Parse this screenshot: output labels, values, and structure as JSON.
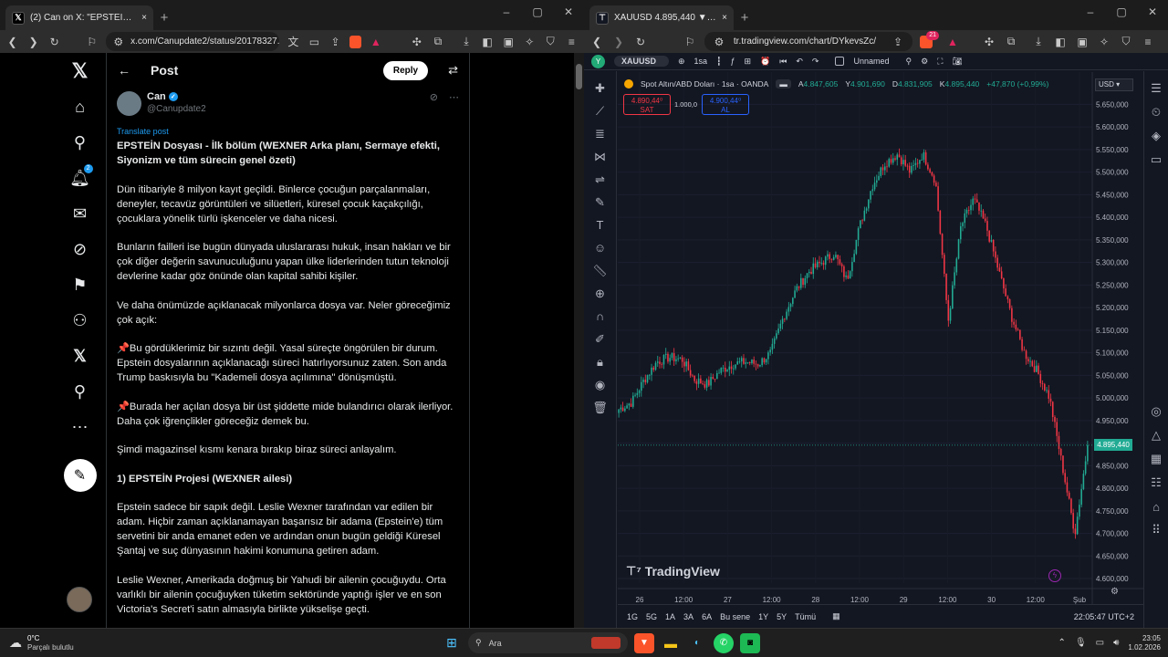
{
  "left": {
    "tab_title": "(2) Can on X: \"EPSTEİN Dosyası -",
    "url": "x.com/Canupdate2/status/20178327...",
    "header": {
      "title": "Post",
      "reply_label": "Reply"
    },
    "author": {
      "name": "Can",
      "handle": "@Canupdate2"
    },
    "notification_count": "2",
    "translate": "Translate post",
    "paragraphs": [
      {
        "text": "EPSTEİN Dosyası - İlk bölüm (WEXNER Arka planı, Sermaye efekti, Siyonizm ve tüm sürecin genel özeti)",
        "bold": true
      },
      {
        "text": "Dün itibariyle 8 milyon kayıt geçildi. Binlerce çocuğun parçalanmaları, deneyler, tecavüz görüntüleri ve silüetleri, küresel çocuk kaçakçılığı, çocuklara yönelik türlü işkenceler ve daha nicesi.",
        "bold": false
      },
      {
        "text": "Bunların failleri ise bugün dünyada uluslararası hukuk, insan hakları ve bir çok diğer değerin savunuculuğunu yapan ülke liderlerinden tutun teknoloji devlerine kadar göz önünde olan kapital sahibi kişiler.",
        "bold": false
      },
      {
        "text": "Ve daha önümüzde açıklanacak milyonlarca dosya var. Neler göreceğimiz çok açık:",
        "bold": false
      },
      {
        "text": "📌Bu gördüklerimiz bir sızıntı değil. Yasal süreçte öngörülen bir durum. Epstein dosyalarının açıklanacağı süreci hatırlıyorsunuz zaten. Son anda Trump baskısıyla bu \"Kademeli dosya açılımına\" dönüşmüştü.",
        "bold": false
      },
      {
        "text": "📌Burada her açılan dosya bir üst şiddette mide bulandırıcı olarak ilerliyor. Daha çok iğrençlikler göreceğiz demek bu.",
        "bold": false
      },
      {
        "text": "Şimdi magazinsel kısmı kenara bırakıp biraz süreci anlayalım.",
        "bold": false
      },
      {
        "text": "1) EPSTEİN Projesi (WEXNER ailesi)",
        "bold": true
      },
      {
        "text": "Epstein sadece bir sapık değil. Leslie Wexner tarafından var edilen bir adam. Hiçbir zaman açıklanamayan başarısız bir adama (Epstein'e) tüm servetini bir anda emanet eden ve ardından onun bugün geldiği Küresel Şantaj ve suç dünyasının hakimi konumuna getiren adam.",
        "bold": false
      },
      {
        "text": " Leslie Wexner, Amerikada doğmuş bir Yahudi bir ailenin çocuğuydu. Orta varlıklı bir ailenin çocuğuyken tüketim sektöründe yaptığı işler ve en son Victoria's Secret'i satın almasıyla birlikte yükselişe geçti.",
        "bold": false
      }
    ]
  },
  "right": {
    "tab_title": "XAUUSD 4.895,440 ▼ −8.84% U",
    "url": "tr.tradingview.com/chart/DYkevsZc/",
    "symbol": "XAUUSD",
    "interval": "1sa",
    "layout_name": "Unnamed",
    "legend_title": "Spot Altın/ABD Doları · 1sa · OANDA",
    "ohlc": {
      "a": "A",
      "a_val": "4.847,605",
      "y": "Y",
      "y_val": "4.901,690",
      "d": "D",
      "d_val": "4.831,905",
      "k": "K",
      "k_val": "4.895,440",
      "chg": "+47,870 (+0,99%)"
    },
    "sell": {
      "price": "4.890,44⁰",
      "label": "SAT"
    },
    "spread": "1.000,0",
    "buy": {
      "price": "4.900,44⁰",
      "label": "AL"
    },
    "currency": "USD",
    "current_price": "4.895,440",
    "watermark": "TradingView",
    "ranges": [
      "1G",
      "5G",
      "1A",
      "3A",
      "6A",
      "Bu sene",
      "1Y",
      "5Y",
      "Tümü"
    ],
    "clock": "22:05:47 UTC+2",
    "accent_up": "#22ab94",
    "accent_down": "#f23645"
  },
  "chart_data": {
    "type": "candlestick",
    "x_ticks": [
      "26",
      "12:00",
      "27",
      "12:00",
      "28",
      "12:00",
      "29",
      "12:00",
      "30",
      "12:00",
      "Şub"
    ],
    "y_ticks": [
      "5.650,000",
      "5.600,000",
      "5.550,000",
      "5.500,000",
      "5.450,000",
      "5.400,000",
      "5.350,000",
      "5.300,000",
      "5.250,000",
      "5.200,000",
      "5.150,000",
      "5.100,000",
      "5.050,000",
      "5.000,000",
      "4.950,000",
      "4.900,000",
      "4.850,000",
      "4.800,000",
      "4.750,000",
      "4.700,000",
      "4.650,000",
      "4.600,000"
    ],
    "ylim": [
      4590,
      5665
    ],
    "close_anchors": [
      4975,
      4990,
      5040,
      5080,
      5090,
      5085,
      5040,
      5030,
      5060,
      5075,
      5080,
      5075,
      5100,
      5180,
      5240,
      5280,
      5300,
      5320,
      5260,
      5380,
      5470,
      5520,
      5540,
      5500,
      5540,
      5480,
      5170,
      5380,
      5440,
      5380,
      5280,
      5180,
      5100,
      5060,
      5000,
      4850,
      4700,
      4895
    ],
    "current": 4895.44
  },
  "taskbar": {
    "temp": "0°C",
    "weather": "Parçalı bulutlu",
    "search": "Ara",
    "time": "23:05",
    "date": "1.02.2026"
  }
}
